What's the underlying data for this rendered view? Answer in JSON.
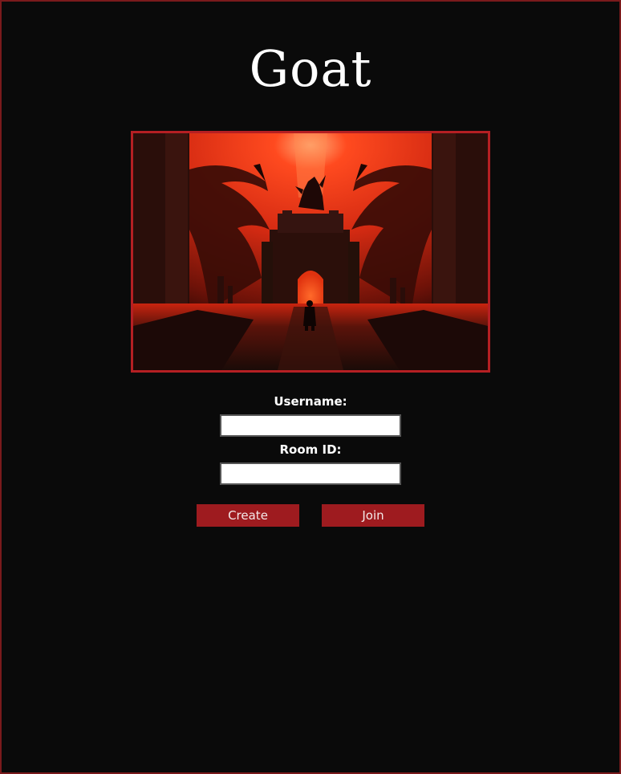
{
  "app": {
    "title": "Goat"
  },
  "hero": {
    "image_description_name": "dragon-gate-artwork"
  },
  "form": {
    "username_label": "Username:",
    "username_value": "",
    "room_label": "Room ID:",
    "room_value": ""
  },
  "actions": {
    "create_label": "Create",
    "join_label": "Join"
  },
  "colors": {
    "background": "#0a0a0a",
    "border": "#7a1a1c",
    "image_border": "#b51f23",
    "button": "#9e1b1f",
    "title_text": "#ffffff"
  }
}
